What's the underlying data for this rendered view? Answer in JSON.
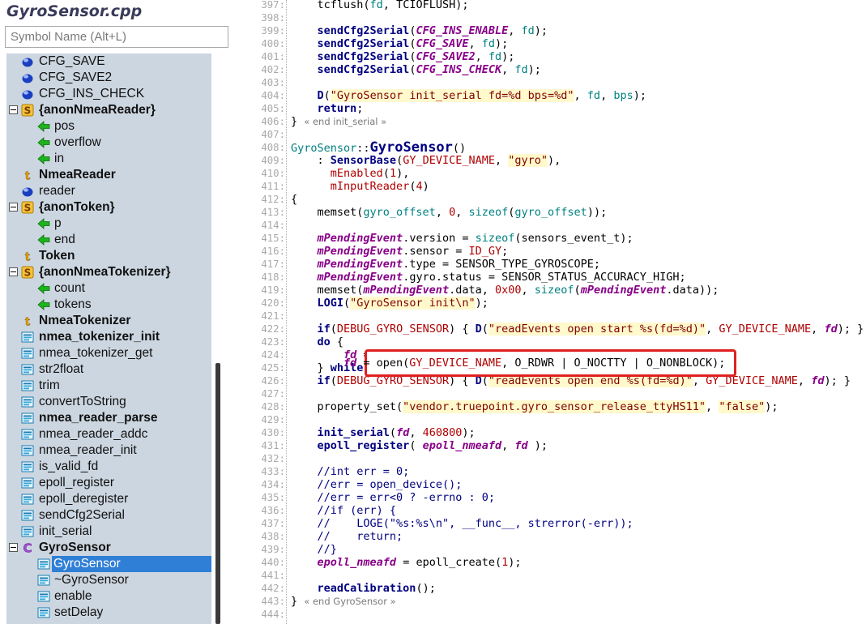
{
  "file": {
    "title": "GyroSensor.cpp"
  },
  "search": {
    "placeholder": "Symbol Name (Alt+L)"
  },
  "tree": [
    {
      "label": "CFG_SAVE",
      "icon": "variable-icon",
      "indent": 1,
      "bold": false
    },
    {
      "label": "CFG_SAVE2",
      "icon": "variable-icon",
      "indent": 1,
      "bold": false
    },
    {
      "label": "CFG_INS_CHECK",
      "icon": "variable-icon",
      "indent": 1,
      "bold": false
    },
    {
      "label": "{anonNmeaReader}",
      "icon": "struct-icon",
      "indent": 1,
      "bold": true,
      "expand": true
    },
    {
      "label": "pos",
      "icon": "member-icon",
      "indent": 2,
      "bold": false
    },
    {
      "label": "overflow",
      "icon": "member-icon",
      "indent": 2,
      "bold": false
    },
    {
      "label": "in",
      "icon": "member-icon",
      "indent": 2,
      "bold": false
    },
    {
      "label": "NmeaReader",
      "icon": "typedef-icon",
      "indent": 1,
      "bold": true
    },
    {
      "label": "reader",
      "icon": "variable-icon",
      "indent": 1,
      "bold": false
    },
    {
      "label": "{anonToken}",
      "icon": "struct-icon",
      "indent": 1,
      "bold": true,
      "expand": true
    },
    {
      "label": "p",
      "icon": "member-icon",
      "indent": 2,
      "bold": false
    },
    {
      "label": "end",
      "icon": "member-icon",
      "indent": 2,
      "bold": false
    },
    {
      "label": "Token",
      "icon": "typedef-icon",
      "indent": 1,
      "bold": true
    },
    {
      "label": "{anonNmeaTokenizer}",
      "icon": "struct-icon",
      "indent": 1,
      "bold": true,
      "expand": true
    },
    {
      "label": "count",
      "icon": "member-icon",
      "indent": 2,
      "bold": false
    },
    {
      "label": "tokens",
      "icon": "member-icon",
      "indent": 2,
      "bold": false
    },
    {
      "label": "NmeaTokenizer",
      "icon": "typedef-icon",
      "indent": 1,
      "bold": true
    },
    {
      "label": "nmea_tokenizer_init",
      "icon": "function-icon",
      "indent": 1,
      "bold": true
    },
    {
      "label": "nmea_tokenizer_get",
      "icon": "function-icon",
      "indent": 1,
      "bold": false
    },
    {
      "label": "str2float",
      "icon": "function-icon",
      "indent": 1,
      "bold": false
    },
    {
      "label": "trim",
      "icon": "function-icon",
      "indent": 1,
      "bold": false
    },
    {
      "label": "convertToString",
      "icon": "function-icon",
      "indent": 1,
      "bold": false
    },
    {
      "label": "nmea_reader_parse",
      "icon": "function-icon",
      "indent": 1,
      "bold": true
    },
    {
      "label": "nmea_reader_addc",
      "icon": "function-icon",
      "indent": 1,
      "bold": false
    },
    {
      "label": "nmea_reader_init",
      "icon": "function-icon",
      "indent": 1,
      "bold": false
    },
    {
      "label": "is_valid_fd",
      "icon": "function-icon",
      "indent": 1,
      "bold": false
    },
    {
      "label": "epoll_register",
      "icon": "function-icon",
      "indent": 1,
      "bold": false
    },
    {
      "label": "epoll_deregister",
      "icon": "function-icon",
      "indent": 1,
      "bold": false
    },
    {
      "label": "sendCfg2Serial",
      "icon": "function-icon",
      "indent": 1,
      "bold": false
    },
    {
      "label": "init_serial",
      "icon": "function-icon",
      "indent": 1,
      "bold": false
    },
    {
      "label": "GyroSensor",
      "icon": "class-icon",
      "indent": 1,
      "bold": true,
      "expand": true
    },
    {
      "label": "GyroSensor",
      "icon": "method-icon",
      "indent": 2,
      "bold": false,
      "selected": true
    },
    {
      "label": "~GyroSensor",
      "icon": "method-icon",
      "indent": 2,
      "bold": false
    },
    {
      "label": "enable",
      "icon": "method-icon",
      "indent": 2,
      "bold": false
    },
    {
      "label": "setDelay",
      "icon": "method-icon",
      "indent": 2,
      "bold": false
    }
  ],
  "code": [
    {
      "n": "397:",
      "html": "    tcflush(<span class='cls'>fd</span>, TCIOFLUSH);"
    },
    {
      "n": "398:",
      "html": ""
    },
    {
      "n": "399:",
      "html": "    <span class='fn'>sendCfg2Serial</span>(<span class='var'>CFG_INS_ENABLE</span>, <span class='cls'>fd</span>);"
    },
    {
      "n": "400:",
      "html": "    <span class='fn'>sendCfg2Serial</span>(<span class='var'>CFG_SAVE</span>, <span class='cls'>fd</span>);"
    },
    {
      "n": "401:",
      "html": "    <span class='fn'>sendCfg2Serial</span>(<span class='var'>CFG_SAVE2</span>, <span class='cls'>fd</span>);"
    },
    {
      "n": "402:",
      "html": "    <span class='fn'>sendCfg2Serial</span>(<span class='var'>CFG_INS_CHECK</span>, <span class='cls'>fd</span>);"
    },
    {
      "n": "403:",
      "html": ""
    },
    {
      "n": "404:",
      "html": "    <span class='fn'>D</span>(<span class='str'>\"GyroSensor init_serial fd=%d bps=%d\"</span>, <span class='cls'>fd</span>, <span class='cls'>bps</span>);"
    },
    {
      "n": "405:",
      "html": "    <span class='kw'>return</span>;"
    },
    {
      "n": "406:",
      "html": "} <span class='fold'>« end init_serial »</span>"
    },
    {
      "n": "407:",
      "html": ""
    },
    {
      "n": "408:",
      "html": "<span class='cls'>GyroSensor</span>::<span class='big'>GyroSensor</span>()"
    },
    {
      "n": "409:",
      "html": "    : <span class='fn'>SensorBase</span>(<span class='mac'>GY_DEVICE_NAME</span>, <span class='str'>\"gyro\"</span>),"
    },
    {
      "n": "410:",
      "html": "      <span class='mac'>mEnabled</span>(<span class='num'>1</span>),"
    },
    {
      "n": "411:",
      "html": "      <span class='mac'>mInputReader</span>(<span class='num'>4</span>)"
    },
    {
      "n": "412:",
      "html": "{"
    },
    {
      "n": "413:",
      "html": "    memset(<span class='cls'>gyro_offset</span>, <span class='num'>0</span>, <span class='cls'>sizeof</span>(<span class='cls'>gyro_offset</span>));"
    },
    {
      "n": "414:",
      "html": ""
    },
    {
      "n": "415:",
      "html": "    <span class='var'>mPendingEvent</span>.version = <span class='cls'>sizeof</span>(sensors_event_t);"
    },
    {
      "n": "416:",
      "html": "    <span class='var'>mPendingEvent</span>.sensor = <span class='mac'>ID_GY</span>;"
    },
    {
      "n": "417:",
      "html": "    <span class='var'>mPendingEvent</span>.type = SENSOR_TYPE_GYROSCOPE;"
    },
    {
      "n": "418:",
      "html": "    <span class='var'>mPendingEvent</span>.gyro.status = SENSOR_STATUS_ACCURACY_HIGH;"
    },
    {
      "n": "419:",
      "html": "    memset(<span class='var'>mPendingEvent</span>.data, <span class='num'>0x00</span>, <span class='cls'>sizeof</span>(<span class='var'>mPendingEvent</span>.data));"
    },
    {
      "n": "420:",
      "html": "    <span class='fn'>LOGI</span>(<span class='str'>\"GyroSensor init\\n\"</span>);"
    },
    {
      "n": "421:",
      "html": ""
    },
    {
      "n": "422:",
      "html": "    <span class='kw'>if</span>(<span class='mac'>DEBUG_GYRO_SENSOR</span>) { <span class='fn'>D</span>(<span class='str'>\"readEvents open start %s(fd=%d)\"</span>, <span class='mac'>GY_DEVICE_NAME</span>, <span class='var'>fd</span>); }"
    },
    {
      "n": "423:",
      "html": "    <span class='kw'>do</span> {"
    },
    {
      "n": "424:",
      "html": "        <span class='var'>fd</span> = open(<span class='mac'>GY_DEVICE_NAME</span>, O_RDWR | O_NOCTTY | O_NONBLOCK);"
    },
    {
      "n": "425:",
      "html": "    } <span class='kw'>while</span> (<span class='var'>fd</span> &lt; <span class='num'>0</span> &amp;&amp; errno == EINTR);"
    },
    {
      "n": "426:",
      "html": "    <span class='kw'>if</span>(<span class='mac'>DEBUG_GYRO_SENSOR</span>) { <span class='fn'>D</span>(<span class='str'>\"readEvents open end %s(fd=%d)\"</span>, <span class='mac'>GY_DEVICE_NAME</span>, <span class='var'>fd</span>); }"
    },
    {
      "n": "427:",
      "html": ""
    },
    {
      "n": "428:",
      "html": "    property_set(<span class='str'>\"vendor.truepoint.gyro_sensor_release_ttyHS11\"</span>, <span class='str'>\"false\"</span>);"
    },
    {
      "n": "429:",
      "html": ""
    },
    {
      "n": "430:",
      "html": "    <span class='fn'>init_serial</span>(<span class='var'>fd</span>, <span class='num'>460800</span>);"
    },
    {
      "n": "431:",
      "html": "    <span class='fn'>epoll_register</span>( <span class='var'>epoll_nmeafd</span>, <span class='var'>fd</span> );"
    },
    {
      "n": "432:",
      "html": ""
    },
    {
      "n": "433:",
      "html": "    <span class='cm'>//int err = 0;</span>"
    },
    {
      "n": "434:",
      "html": "    <span class='cm'>//err = open_device();</span>"
    },
    {
      "n": "435:",
      "html": "    <span class='cm'>//err = err&lt;0 ? -errno : 0;</span>"
    },
    {
      "n": "436:",
      "html": "    <span class='cm'>//if (err) {</span>"
    },
    {
      "n": "437:",
      "html": "    <span class='cm'>//    LOGE(\"%s:%s\\n\", __func__, strerror(-err));</span>"
    },
    {
      "n": "438:",
      "html": "    <span class='cm'>//    return;</span>"
    },
    {
      "n": "439:",
      "html": "    <span class='cm'>//}</span>"
    },
    {
      "n": "440:",
      "html": "    <span class='var'>epoll_nmeafd</span> = epoll_create(<span class='num'>1</span>);"
    },
    {
      "n": "441:",
      "html": ""
    },
    {
      "n": "442:",
      "html": "    <span class='fn'>readCalibration</span>();"
    },
    {
      "n": "443:",
      "html": "} <span class='fold'>« end GyroSensor »</span>"
    },
    {
      "n": "444:",
      "html": ""
    }
  ],
  "highlight_line_html": "<span class='var'>fd</span> = open(<span class='mac'>GY_DEVICE_NAME</span>, O_RDWR | O_NOCTTY | O_NONBLOCK);"
}
